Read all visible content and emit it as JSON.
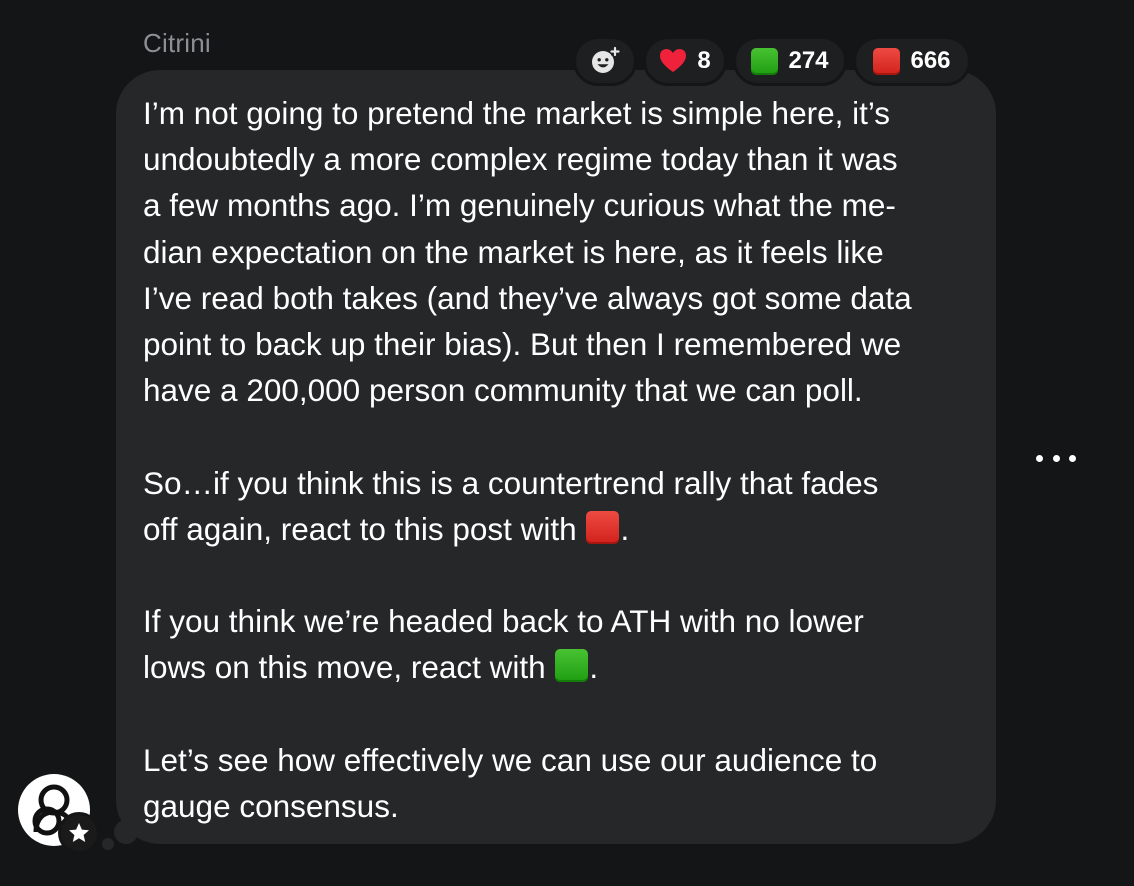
{
  "message": {
    "sender": "Citrini",
    "paragraphs": [
      {
        "lines": [
          "I’m not going to pretend the market is simple here, it’s",
          "undoubtedly a more complex regime today than it was",
          "a few months ago. I’m genuinely curious what the me-",
          "dian expectation on the market is here, as it feels like",
          "I’ve read both takes (and they’ve always got some data",
          "point to back up their bias). But then I remembered we",
          "have a 200,000 person community that we can poll."
        ]
      },
      {
        "lines": [
          "So…if you think this is a countertrend rally that fades",
          "off again, react to this post with"
        ],
        "trailing_emoji": "red-square",
        "trailing_text": "."
      },
      {
        "lines": [
          "If you think we’re headed back to ATH with no lower",
          "lows on this move, react with"
        ],
        "trailing_emoji": "green-square",
        "trailing_text": "."
      },
      {
        "lines": [
          "Let’s see how effectively we can use our audience to",
          "gauge consensus."
        ]
      }
    ]
  },
  "reactions": [
    {
      "icon": "heart-icon",
      "count": "8"
    },
    {
      "icon": "green-square-icon",
      "count": "274"
    },
    {
      "icon": "red-square-icon",
      "count": "666"
    }
  ],
  "colors": {
    "background": "#141516",
    "bubble": "#262728",
    "sender": "#8e8f93",
    "red_square": "#de2a22",
    "green_square": "#2aab1a",
    "heart": "#f0213a"
  },
  "icons": {
    "add_reaction": "add-reaction-icon",
    "more": "more-options-icon",
    "avatar": "citrini-logo",
    "badge": "star-badge-icon"
  }
}
